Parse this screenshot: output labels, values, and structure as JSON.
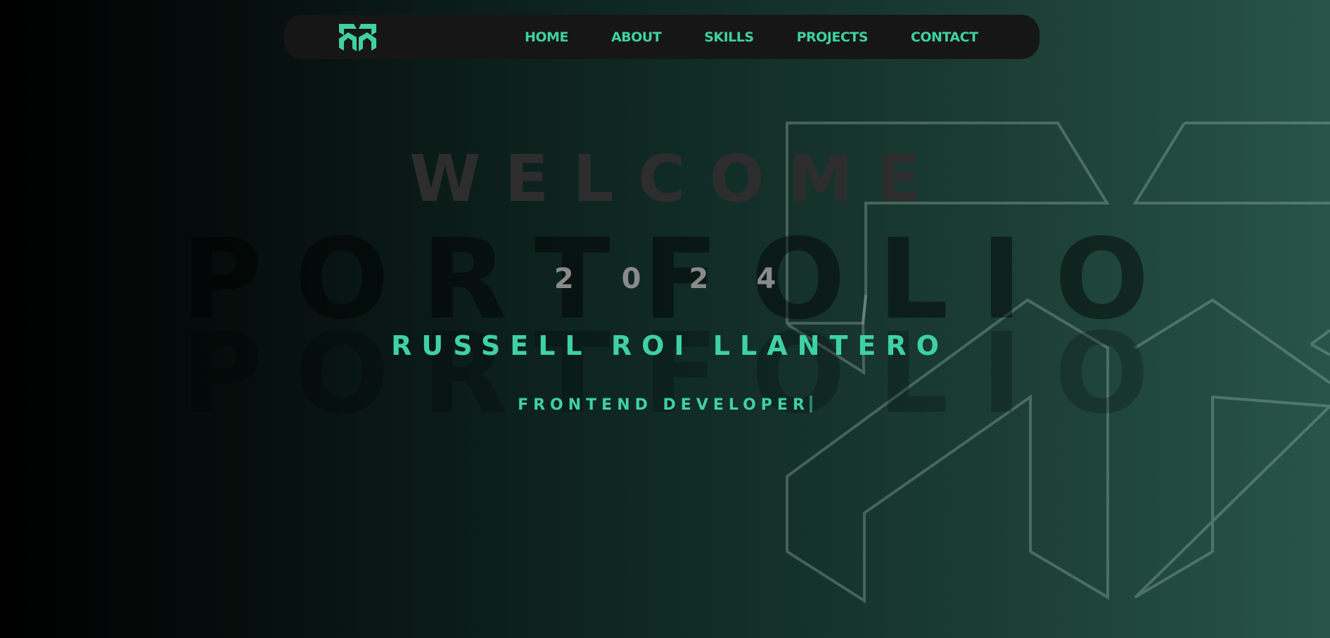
{
  "navbar": {
    "logo_icon": "rr-monogram-logo-icon",
    "items": [
      {
        "label": "HOME"
      },
      {
        "label": "ABOUT"
      },
      {
        "label": "SKILLS"
      },
      {
        "label": "PROJECTS"
      },
      {
        "label": "CONTACT"
      }
    ]
  },
  "hero": {
    "background_word_top": "WELCOME",
    "background_word_main": "PORTFOLIO",
    "background_word_echo": "PORTFOLIO",
    "year": "2024",
    "name": "RUSSELL ROI LLANTERO",
    "role": "FRONTEND DEVELOPER"
  },
  "background_logo_icon": "rr-monogram-outline-icon",
  "colors": {
    "accent": "#3fd1a1",
    "navbar_bg": "#161616",
    "gradient_start": "#000000",
    "gradient_end": "#285548"
  }
}
